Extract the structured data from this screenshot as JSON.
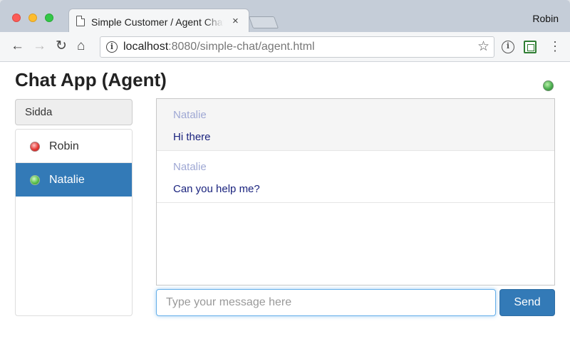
{
  "browser": {
    "tab_title": "Simple Customer / Agent Chat",
    "tab_close": "×",
    "profile_name": "Robin",
    "url_host": "localhost",
    "url_path": ":8080/simple-chat/agent.html"
  },
  "app": {
    "title": "Chat App (Agent)",
    "agent_status": "online",
    "agent_name": "Sidda"
  },
  "customers": [
    {
      "name": "Robin",
      "status": "offline",
      "selected": false
    },
    {
      "name": "Natalie",
      "status": "online",
      "selected": true
    }
  ],
  "messages": [
    {
      "author": "Natalie",
      "text": "Hi there"
    },
    {
      "author": "Natalie",
      "text": "Can you help me?"
    }
  ],
  "composer": {
    "placeholder": "Type your message here",
    "send_label": "Send"
  },
  "colors": {
    "accent": "#337ab7",
    "message_text": "#1a237e",
    "author_text": "#9fa8d4",
    "online": "#4caf50",
    "offline": "#e53935"
  }
}
